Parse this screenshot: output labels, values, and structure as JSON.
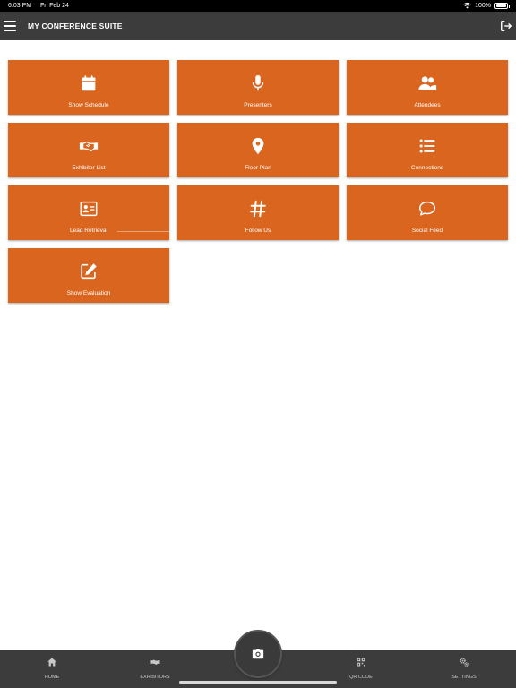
{
  "status_bar": {
    "time": "6:03 PM",
    "date": "Fri Feb 24",
    "battery": "100%",
    "battery_level": 1.0
  },
  "header": {
    "title": "MY CONFERENCE SUITE",
    "menu_icon": "hamburger-menu-icon",
    "logout_icon": "logout-icon"
  },
  "tiles": [
    {
      "label": "Show Schedule",
      "icon": "calendar-icon"
    },
    {
      "label": "Presenters",
      "icon": "microphone-icon"
    },
    {
      "label": "Attendees",
      "icon": "users-icon"
    },
    {
      "label": "Exhibitor List",
      "icon": "handshake-icon"
    },
    {
      "label": "Floor Plan",
      "icon": "map-pin-icon"
    },
    {
      "label": "Connections",
      "icon": "list-icon"
    },
    {
      "label": "Lead Retrieval",
      "icon": "id-card-icon"
    },
    {
      "label": "Follow Us",
      "icon": "hashtag-icon"
    },
    {
      "label": "Social Feed",
      "icon": "speech-bubble-icon"
    },
    {
      "label": "Show Evaluation",
      "icon": "edit-icon"
    }
  ],
  "bottom_nav": [
    {
      "label": "HOME",
      "icon": "home-icon"
    },
    {
      "label": "EXHIBITORS",
      "icon": "handshake-icon"
    },
    {
      "label": "QR CODE",
      "icon": "qr-code-icon"
    },
    {
      "label": "SETTINGS",
      "icon": "gears-icon"
    }
  ],
  "camera_button": {
    "icon": "camera-icon"
  },
  "colors": {
    "tile": "#d9651f",
    "header": "#3c3c3c",
    "status_bar": "#000000",
    "nav_text": "#c8c8c8"
  }
}
